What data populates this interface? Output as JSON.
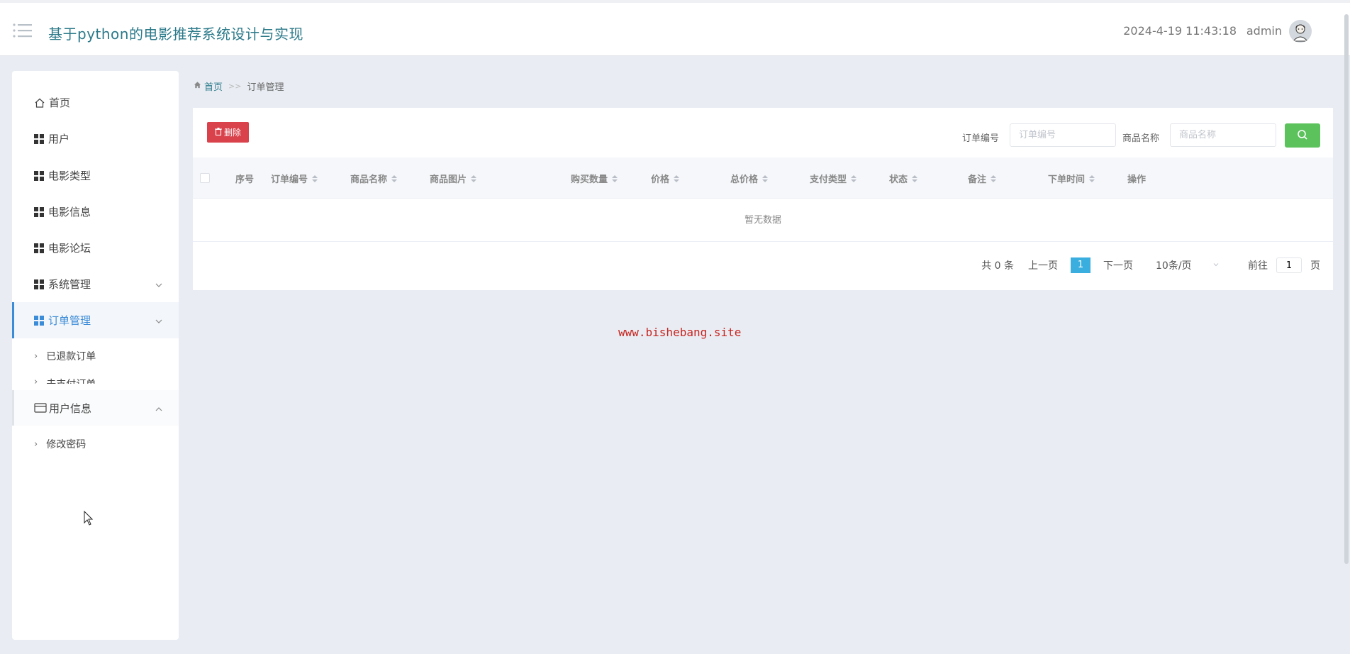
{
  "header": {
    "title": "基于python的电影推荐系统设计与实现",
    "datetime": "2024-4-19 11:43:18",
    "username": "admin"
  },
  "sidebar": {
    "items": [
      {
        "label": "首页",
        "icon": "home-icon"
      },
      {
        "label": "用户",
        "icon": "grid-icon"
      },
      {
        "label": "电影类型",
        "icon": "grid-icon"
      },
      {
        "label": "电影信息",
        "icon": "grid-icon"
      },
      {
        "label": "电影论坛",
        "icon": "grid-icon"
      },
      {
        "label": "系统管理",
        "icon": "grid-icon",
        "has_children": true
      },
      {
        "label": "订单管理",
        "icon": "grid-icon",
        "has_children": true,
        "active": true
      },
      {
        "label": "用户信息",
        "icon": "card-icon",
        "has_children": true,
        "expanded": true
      }
    ],
    "order_sub": [
      "已退款订单",
      "未支付订单"
    ],
    "user_sub": [
      "修改密码"
    ]
  },
  "breadcrumb": {
    "home": "首页",
    "separator": ">>",
    "current": "订单管理"
  },
  "toolbar": {
    "delete_label": "删除",
    "order_no_label": "订单编号",
    "order_no_placeholder": "订单编号",
    "goods_name_label": "商品名称",
    "goods_name_placeholder": "商品名称"
  },
  "table": {
    "columns": [
      "序号",
      "订单编号",
      "商品名称",
      "商品图片",
      "购买数量",
      "价格",
      "总价格",
      "支付类型",
      "状态",
      "备注",
      "下单时间",
      "操作"
    ],
    "empty_text": "暂无数据"
  },
  "pager": {
    "total": "共 0 条",
    "prev": "上一页",
    "current_page": "1",
    "next": "下一页",
    "page_size": "10条/页",
    "goto_label": "前往",
    "goto_value": "1",
    "page_suffix": "页"
  },
  "watermark": "www.bishebang.site",
  "colors": {
    "accent": "#2c7a8a",
    "active": "#3a8bd8",
    "delete": "#d9414b",
    "search": "#5cc25c",
    "page": "#3aaede"
  }
}
